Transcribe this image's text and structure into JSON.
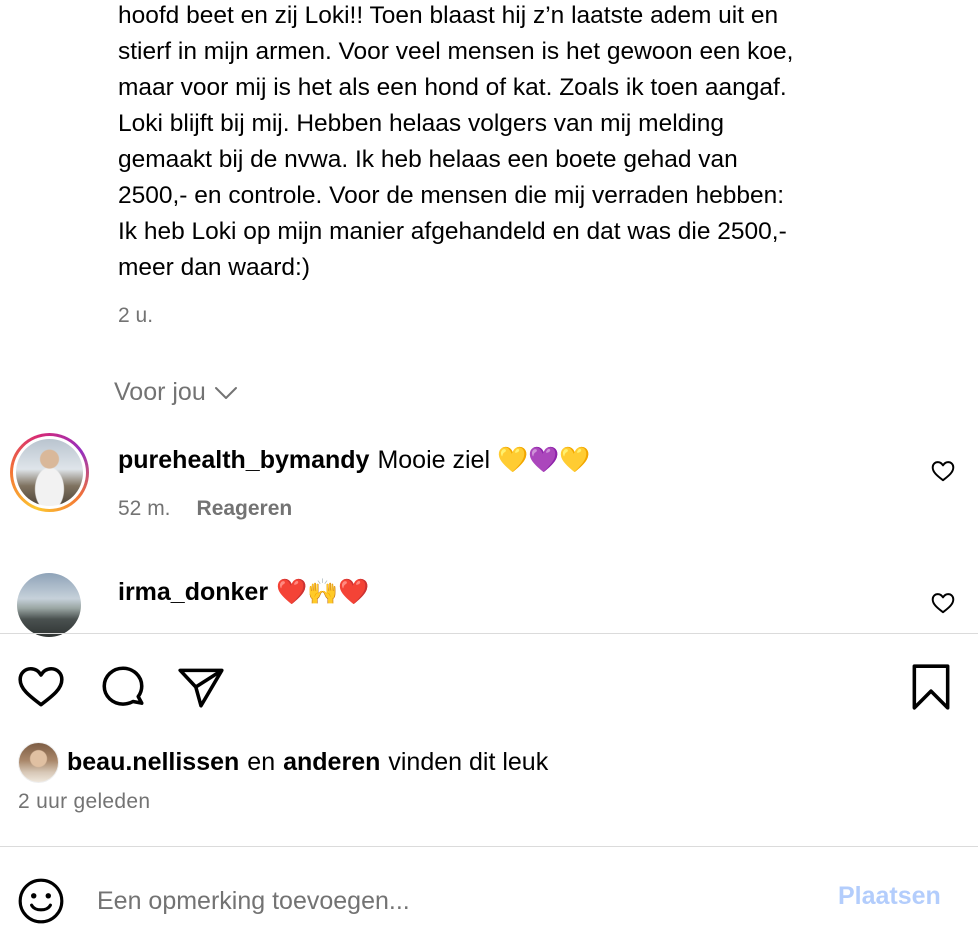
{
  "caption": {
    "text": "hoofd beet en zij Loki!! Toen blaast hij z’n laatste adem uit en\nstierf in mijn armen. Voor veel mensen is het gewoon een koe,\nmaar voor mij is het als een hond of kat. Zoals ik toen aangaf.\nLoki blijft bij mij. Hebben helaas volgers van mij melding\ngemaakt bij de nvwa. Ik heb helaas een boete gehad van\n2500,- en controle. Voor de mensen die mij verraden hebben:\nIk heb Loki op mijn manier afgehandeld en dat was die 2500,-\nmeer dan waard:)",
    "time": "2 u."
  },
  "filter": {
    "label": "Voor jou",
    "icon": "chevron-down-icon"
  },
  "comments": [
    {
      "username": "purehealth_bymandy",
      "text": "Mooie ziel 💛💜💛",
      "time": "52 m.",
      "reply_label": "Reageren"
    },
    {
      "username": "irma_donker",
      "text": "❤️🙌❤️"
    }
  ],
  "actions": {
    "icons": [
      "heart-icon",
      "comment-icon",
      "share-icon",
      "bookmark-icon"
    ]
  },
  "likes": {
    "user": "beau.nellissen",
    "connector": "en",
    "others": "anderen",
    "suffix": "vinden dit leuk"
  },
  "post_time": "2 uur geleden",
  "comment_box": {
    "placeholder": "Een opmerking toevoegen...",
    "value": "",
    "post_label": "Plaatsen",
    "post_color": "#b3cdfc"
  },
  "colors": {
    "muted_text": "#737373",
    "divider": "#dbdbdb"
  }
}
